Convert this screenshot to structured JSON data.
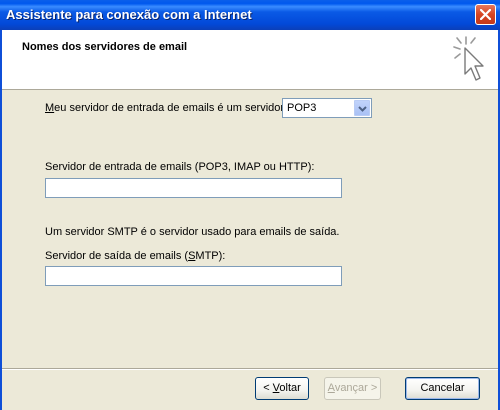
{
  "window": {
    "title": "Assistente para conexão com a Internet"
  },
  "header": {
    "title": "Nomes dos servidores de email"
  },
  "incoming_type": {
    "label_first": "M",
    "label_rest": "eu servidor de entrada de emails é um  servidor",
    "value": "POP3"
  },
  "incoming_server": {
    "label": "Servidor de entrada de emails (POP3, IMAP ou HTTP):",
    "value": ""
  },
  "smtp_info": "Um servidor SMTP é o servidor usado para emails de saída.",
  "outgoing_server": {
    "label_before": "Servidor de saída de emails (",
    "label_accel": "S",
    "label_after": "MTP):",
    "value": ""
  },
  "buttons": {
    "back_prefix": "< ",
    "back_accel": "V",
    "back_rest": "oltar",
    "next_accel": "A",
    "next_rest": "vançar >",
    "cancel": "Cancelar"
  }
}
